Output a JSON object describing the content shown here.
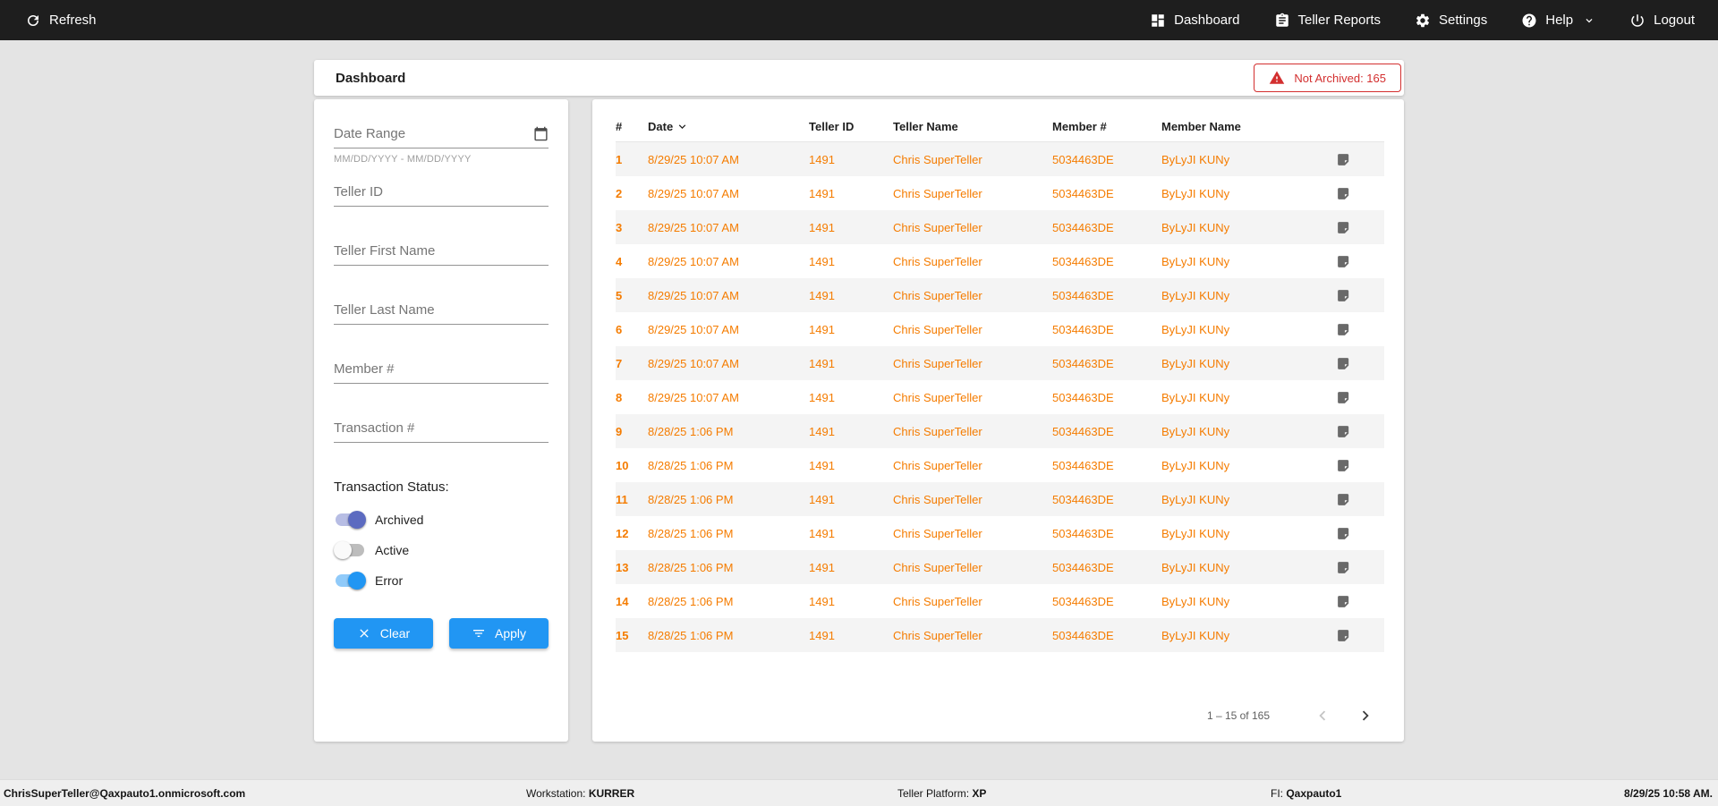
{
  "topbar": {
    "refresh_label": "Refresh",
    "nav": [
      {
        "label": "Dashboard"
      },
      {
        "label": "Teller Reports"
      },
      {
        "label": "Settings"
      },
      {
        "label": "Help"
      },
      {
        "label": "Logout"
      }
    ]
  },
  "header": {
    "title": "Dashboard",
    "not_archived_badge": "Not Archived: 165"
  },
  "filters": {
    "date_range": {
      "label": "Date Range",
      "hint": "MM/DD/YYYY - MM/DD/YYYY"
    },
    "text_fields": [
      {
        "label": "Teller ID"
      },
      {
        "label": "Teller First Name"
      },
      {
        "label": "Teller Last Name"
      },
      {
        "label": "Member #"
      },
      {
        "label": "Transaction #"
      }
    ],
    "status_label": "Transaction Status:",
    "toggles": [
      {
        "label": "Archived",
        "on": true,
        "thumb": "#5C6BC0",
        "track": "#B7BDE4"
      },
      {
        "label": "Active",
        "on": false,
        "thumb": "#FAFAFA",
        "track": "#BDBDBD"
      },
      {
        "label": "Error",
        "on": true,
        "thumb": "#2196F3",
        "track": "#90CAF9"
      }
    ],
    "clear_label": "Clear",
    "apply_label": "Apply"
  },
  "table": {
    "columns": [
      "#",
      "Date",
      "Teller ID",
      "Teller Name",
      "Member #",
      "Member Name"
    ],
    "sorted_column": "Date",
    "rows": [
      {
        "num": "1",
        "date": "8/29/25 10:07 AM",
        "teller_id": "1491",
        "teller_name": "Chris SuperTeller",
        "member": "5034463DE",
        "member_name": "ByLyJI KUNy"
      },
      {
        "num": "2",
        "date": "8/29/25 10:07 AM",
        "teller_id": "1491",
        "teller_name": "Chris SuperTeller",
        "member": "5034463DE",
        "member_name": "ByLyJI KUNy"
      },
      {
        "num": "3",
        "date": "8/29/25 10:07 AM",
        "teller_id": "1491",
        "teller_name": "Chris SuperTeller",
        "member": "5034463DE",
        "member_name": "ByLyJI KUNy"
      },
      {
        "num": "4",
        "date": "8/29/25 10:07 AM",
        "teller_id": "1491",
        "teller_name": "Chris SuperTeller",
        "member": "5034463DE",
        "member_name": "ByLyJI KUNy"
      },
      {
        "num": "5",
        "date": "8/29/25 10:07 AM",
        "teller_id": "1491",
        "teller_name": "Chris SuperTeller",
        "member": "5034463DE",
        "member_name": "ByLyJI KUNy"
      },
      {
        "num": "6",
        "date": "8/29/25 10:07 AM",
        "teller_id": "1491",
        "teller_name": "Chris SuperTeller",
        "member": "5034463DE",
        "member_name": "ByLyJI KUNy"
      },
      {
        "num": "7",
        "date": "8/29/25 10:07 AM",
        "teller_id": "1491",
        "teller_name": "Chris SuperTeller",
        "member": "5034463DE",
        "member_name": "ByLyJI KUNy"
      },
      {
        "num": "8",
        "date": "8/29/25 10:07 AM",
        "teller_id": "1491",
        "teller_name": "Chris SuperTeller",
        "member": "5034463DE",
        "member_name": "ByLyJI KUNy"
      },
      {
        "num": "9",
        "date": "8/28/25 1:06 PM",
        "teller_id": "1491",
        "teller_name": "Chris SuperTeller",
        "member": "5034463DE",
        "member_name": "ByLyJI KUNy"
      },
      {
        "num": "10",
        "date": "8/28/25 1:06 PM",
        "teller_id": "1491",
        "teller_name": "Chris SuperTeller",
        "member": "5034463DE",
        "member_name": "ByLyJI KUNy"
      },
      {
        "num": "11",
        "date": "8/28/25 1:06 PM",
        "teller_id": "1491",
        "teller_name": "Chris SuperTeller",
        "member": "5034463DE",
        "member_name": "ByLyJI KUNy"
      },
      {
        "num": "12",
        "date": "8/28/25 1:06 PM",
        "teller_id": "1491",
        "teller_name": "Chris SuperTeller",
        "member": "5034463DE",
        "member_name": "ByLyJI KUNy"
      },
      {
        "num": "13",
        "date": "8/28/25 1:06 PM",
        "teller_id": "1491",
        "teller_name": "Chris SuperTeller",
        "member": "5034463DE",
        "member_name": "ByLyJI KUNy"
      },
      {
        "num": "14",
        "date": "8/28/25 1:06 PM",
        "teller_id": "1491",
        "teller_name": "Chris SuperTeller",
        "member": "5034463DE",
        "member_name": "ByLyJI KUNy"
      },
      {
        "num": "15",
        "date": "8/28/25 1:06 PM",
        "teller_id": "1491",
        "teller_name": "Chris SuperTeller",
        "member": "5034463DE",
        "member_name": "ByLyJI KUNy"
      }
    ]
  },
  "pagination": {
    "range_label": "1 – 15 of 165"
  },
  "footer": {
    "user": "ChrisSuperTeller@Qaxpauto1.onmicrosoft.com",
    "workstation_label": "Workstation:",
    "workstation_value": "KURRER",
    "platform_label": "Teller Platform:",
    "platform_value": "XP",
    "fi_label": "FI:",
    "fi_value": "Qaxpauto1",
    "datetime": "8/29/25 10:58 AM."
  },
  "colors": {
    "accent_orange": "#F57C00",
    "alert_red": "#D32F2F",
    "button_blue": "#2196F3",
    "topbar_black": "#1E1E1E"
  }
}
